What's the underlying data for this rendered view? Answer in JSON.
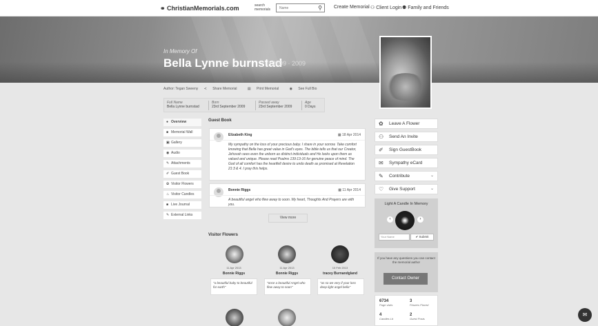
{
  "header": {
    "logo": "ChristianMemorials.com",
    "search_label": "search memorials",
    "search_placeholder": "Name",
    "nav": [
      "Create Memorial",
      "Client Login",
      "Family and Friends"
    ]
  },
  "hero": {
    "in_memory": "In Memory Of",
    "name": "Bella Lynne burnstad",
    "years": "2009 · 2009"
  },
  "author_row": {
    "author": "Author: Tegan Sweeny",
    "share": "Share Memorial",
    "print": "Print Memorial",
    "see_full": "See Full Bio"
  },
  "info": [
    {
      "label": "Full Name",
      "value": "Bella Lynne burnstad"
    },
    {
      "label": "Born",
      "value": "23rd September 2009"
    },
    {
      "label": "Passed away",
      "value": "23rd September 2009"
    },
    {
      "label": "Age",
      "value": "0 Days"
    }
  ],
  "side_menu": [
    {
      "icon": "●",
      "label": "Overview"
    },
    {
      "icon": "■",
      "label": "Memorial Wall"
    },
    {
      "icon": "▣",
      "label": "Gallery"
    },
    {
      "icon": "◉",
      "label": "Audio"
    },
    {
      "icon": "✎",
      "label": "Attachments"
    },
    {
      "icon": "✐",
      "label": "Guest Book"
    },
    {
      "icon": "✿",
      "label": "Visitor Flowers"
    },
    {
      "icon": "♨",
      "label": "Visitor Candles"
    },
    {
      "icon": "■",
      "label": "Live Journal"
    },
    {
      "icon": "✎",
      "label": "External Links"
    }
  ],
  "guestbook": {
    "title": "Guest Book",
    "entries": [
      {
        "name": "Elizabeth King",
        "date": "18 Apr 2014",
        "text": "My sympathy on the loss of your precious baby. I share in your sorrow. Take comfort knowing that Bella has great value in God's eyes. The bible tells us that our Creator, Jehovah sees even the unborn as distinct individuals and He looks upon them as valued and unique. Please read Psalms 139:13-16 for genuine peace of mind. The God of all comfort has the heartfelt desire to undo death as promised at Revelation 21:3 & 4. I pray this helps."
      },
      {
        "name": "Bonnie Riggs",
        "date": "11 Apr 2014",
        "text": "A beautiful angel who flew away to soon. My heart, Thoughts And Prayers are with you."
      }
    ],
    "view_more": "View more"
  },
  "visitor_flowers": {
    "title": "Visitor Flowers",
    "items": [
      {
        "date": "11 Apr 2013",
        "name": "Bonnie Riggs",
        "msg": "\"a beautiful baby to beautiful for earth\""
      },
      {
        "date": "11 Apr 2013",
        "name": "Bonnie Riggs",
        "msg": "\"once a beautiful Angel who flew away to soon\""
      },
      {
        "date": "10 Feb 2013",
        "name": "tracey Burnandgland",
        "msg": "\"as so we very if your loss deep light angel bella\""
      }
    ]
  },
  "actions": [
    {
      "icon": "✿",
      "label": "Leave A Flower"
    },
    {
      "icon": "⚇",
      "label": "Send An Invite"
    },
    {
      "icon": "✐",
      "label": "Sign GuestBook"
    },
    {
      "icon": "✉",
      "label": "Sympathy eCard"
    },
    {
      "icon": "✎",
      "label": "Contribute"
    },
    {
      "icon": "♡",
      "label": "Give Support"
    }
  ],
  "candle": {
    "title": "Light A Candle In Memory",
    "input_placeholder": "Your Name",
    "submit": "✔ Submit"
  },
  "contact": {
    "text": "If you have any questions you can contact the memorial author",
    "button": "Contact Owner"
  },
  "stats": [
    {
      "num": "6734",
      "lbl": "Page visits"
    },
    {
      "num": "3",
      "lbl": "Flowers Placed"
    },
    {
      "num": "4",
      "lbl": "Candles Lit"
    },
    {
      "num": "2",
      "lbl": "Guest Posts"
    }
  ]
}
